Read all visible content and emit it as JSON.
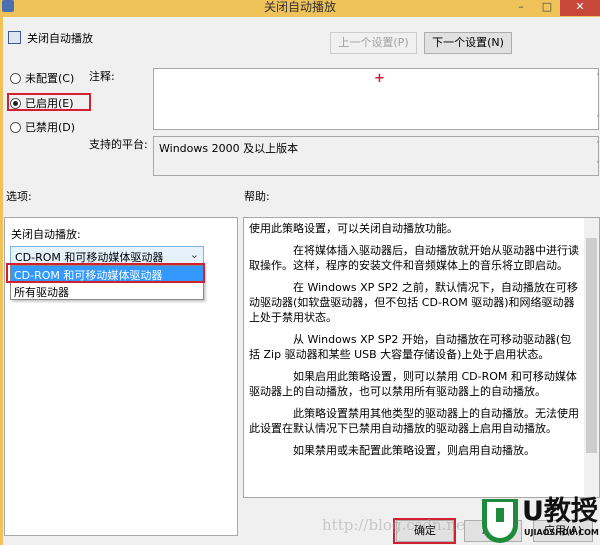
{
  "window": {
    "title": "关闭自动播放",
    "minimize": "–",
    "maximize": "□",
    "close": "✕"
  },
  "header": {
    "policy_name": "关闭自动播放",
    "prev_button": "上一个设置(P)",
    "next_button": "下一个设置(N)"
  },
  "state": {
    "options": [
      {
        "label": "未配置(C)",
        "selected": false
      },
      {
        "label": "已启用(E)",
        "selected": true
      },
      {
        "label": "已禁用(D)",
        "selected": false
      }
    ]
  },
  "comment": {
    "label": "注释:",
    "value": "",
    "cursor_mark": "+"
  },
  "platform": {
    "label": "支持的平台:",
    "value": "Windows 2000 及以上版本"
  },
  "options_section": {
    "label": "选项:",
    "field_label": "关闭自动播放:",
    "selected": "CD-ROM 和可移动媒体驱动器",
    "dropdown_items": [
      "CD-ROM 和可移动媒体驱动器",
      "所有驱动器"
    ]
  },
  "help_section": {
    "label": "帮助:",
    "paragraphs": [
      "使用此策略设置，可以关闭自动播放功能。",
      "在将媒体插入驱动器后，自动播放就开始从驱动器中进行读取操作。这样，程序的安装文件和音频媒体上的音乐将立即启动。",
      "在 Windows XP SP2 之前，默认情况下，自动播放在可移动驱动器(如软盘驱动器，但不包括 CD-ROM 驱动器)和网络驱动器上处于禁用状态。",
      "从 Windows XP SP2 开始，自动播放在可移动驱动器(包括 Zip 驱动器和某些 USB 大容量存储设备)上处于启用状态。",
      "如果启用此策略设置，则可以禁用 CD-ROM 和可移动媒体驱动器上的自动播放，也可以禁用所有驱动器上的自动播放。",
      "此策略设置禁用其他类型的驱动器上的自动播放。无法使用此设置在默认情况下已禁用自动播放的驱动器上启用自动播放。",
      "如果禁用或未配置此策略设置，则启用自动播放。"
    ]
  },
  "footer": {
    "ok": "确定",
    "cancel": "取消",
    "apply": "应用(A)"
  },
  "watermark": {
    "url": "http://blog.csdn.ne",
    "logo_text": "U教授",
    "logo_sub": "UJIAOSHOU.COM"
  },
  "colors": {
    "titlebar": "#efc35a",
    "highlight": "#3399ff",
    "annotation": "#d32030",
    "logo": "#1e8a3c"
  }
}
